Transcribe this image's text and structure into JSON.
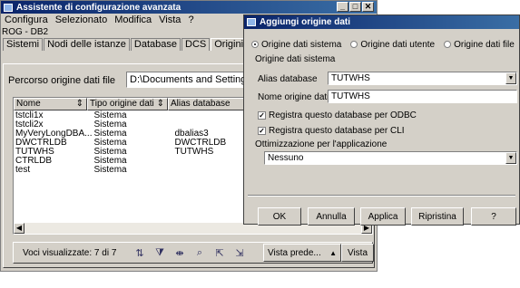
{
  "main_window": {
    "title": "Assistente di configurazione avanzata",
    "menu": [
      "Configura",
      "Selezionato",
      "Modifica",
      "Vista",
      "?"
    ],
    "path": "ROG - DB2",
    "tabs": [
      "Sistemi",
      "Nodi delle istanze",
      "Database",
      "DCS",
      "Origini d"
    ],
    "path_label": "Percorso origine dati file",
    "path_value": "D:\\Documents and Settings\\",
    "columns": [
      "Nome",
      "Tipo origine dati",
      "Alias database"
    ],
    "rows": [
      {
        "name": "tstcli1x",
        "type": "Sistema",
        "alias": ""
      },
      {
        "name": "tstcli2x",
        "type": "Sistema",
        "alias": ""
      },
      {
        "name": "MyVeryLongDBA...",
        "type": "Sistema",
        "alias": "dbalias3"
      },
      {
        "name": "DWCTRLDB",
        "type": "Sistema",
        "alias": "DWCTRLDB"
      },
      {
        "name": "TUTWHS",
        "type": "Sistema",
        "alias": "TUTWHS"
      },
      {
        "name": "CTRLDB",
        "type": "Sistema",
        "alias": ""
      },
      {
        "name": "test",
        "type": "Sistema",
        "alias": ""
      }
    ],
    "count_label": "Voci visualizzate: 7 di 7",
    "view_button": "Vista prede...",
    "view_button2": "Vista",
    "toolbar_icons": [
      "sort-icon",
      "filter-icon",
      "filter-columns-icon",
      "find-icon",
      "select-all-icon",
      "deselect-all-icon"
    ]
  },
  "dialog": {
    "title": "Aggiungi origine dati",
    "radios": [
      "Origine dati sistema",
      "Origine dati utente",
      "Origine dati file"
    ],
    "selected_radio": 0,
    "group_label": "Origine dati sistema",
    "alias_label": "Alias database",
    "alias_value": "TUTWHS",
    "name_label": "Nome origine dati",
    "name_value": "TUTWHS",
    "check_odbc": "Registra questo database per ODBC",
    "check_cli": "Registra questo database per CLI",
    "opt_label": "Ottimizzazione per l'applicazione",
    "opt_value": "Nessuno",
    "buttons": [
      "OK",
      "Annulla",
      "Applica",
      "Ripristina",
      "?"
    ]
  }
}
